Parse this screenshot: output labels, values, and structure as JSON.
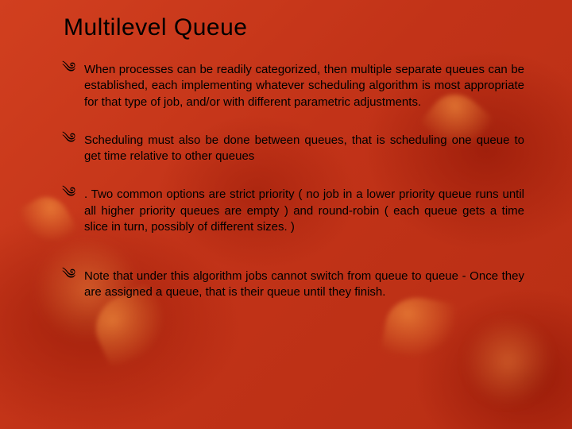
{
  "title": "Multilevel Queue",
  "bulletGlyph": "༄",
  "bullets": [
    "When processes can be readily categorized, then multiple separate queues can be established, each implementing whatever scheduling algorithm is most appropriate for that type of job, and/or with different parametric adjustments.",
    "Scheduling must also be done between queues, that is scheduling one queue to get time relative to other queues",
    ". Two common options are strict priority ( no job in a lower priority queue runs until all higher priority queues are empty ) and round-robin ( each queue gets a time slice in turn, possibly of different sizes. )",
    "Note that under this algorithm jobs cannot switch from queue to queue - Once they are assigned a queue, that is their queue until they finish."
  ]
}
